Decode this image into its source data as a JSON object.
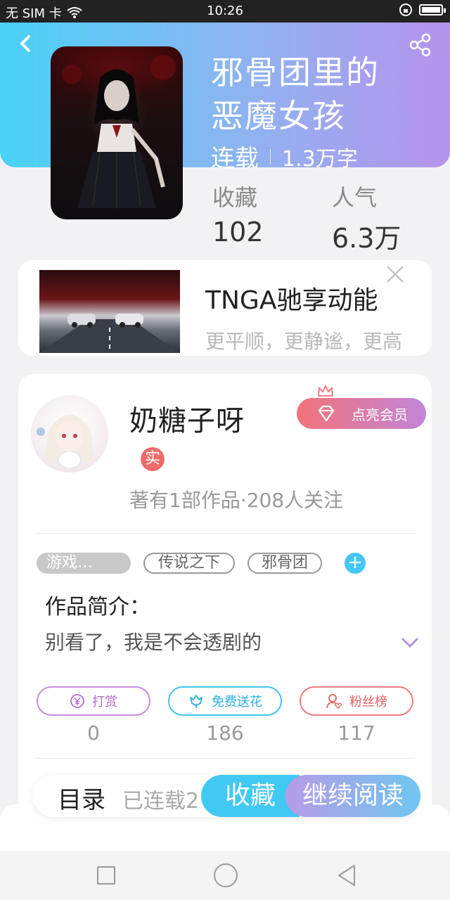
{
  "status_bar": {
    "carrier": "无 SIM 卡",
    "time": "10:26",
    "wifi_icon": "wifi-icon",
    "battery_icon": "battery-icon"
  },
  "book": {
    "title_line1": "邪骨团里的",
    "title_line2": "恶魔女孩",
    "status": "连载",
    "word_count": "1.3万字",
    "favorites_label": "收藏",
    "favorites_value": "102",
    "popularity_label": "人气",
    "popularity_value": "6.3万"
  },
  "ad": {
    "title": "TNGA驰享动能",
    "subtitle": "更平顺，更静谧，更高"
  },
  "author": {
    "name": "奶糖子呀",
    "real_badge": "实",
    "vip_button": "点亮会员",
    "stats": "著有1部作品·208人关注"
  },
  "tags": [
    "游戏…",
    "传说之下",
    "邪骨团"
  ],
  "intro": {
    "title": "作品简介：",
    "text": "别看了，我是不会透剧的"
  },
  "actions": {
    "tip_label": "打赏",
    "tip_count": "0",
    "flower_label": "免费送花",
    "flower_count": "186",
    "fans_label": "粉丝榜",
    "fans_count": "117"
  },
  "bottom_bar": {
    "toc_label": "目录",
    "toc_status": "已连载2",
    "favorite_button": "收藏",
    "read_button": "继续阅读"
  },
  "colors": {
    "header_gradient_start": "#49d2f6",
    "header_gradient_end": "#b693ec",
    "accent_blue": "#42c9f3",
    "accent_purple": "#b79be8"
  }
}
